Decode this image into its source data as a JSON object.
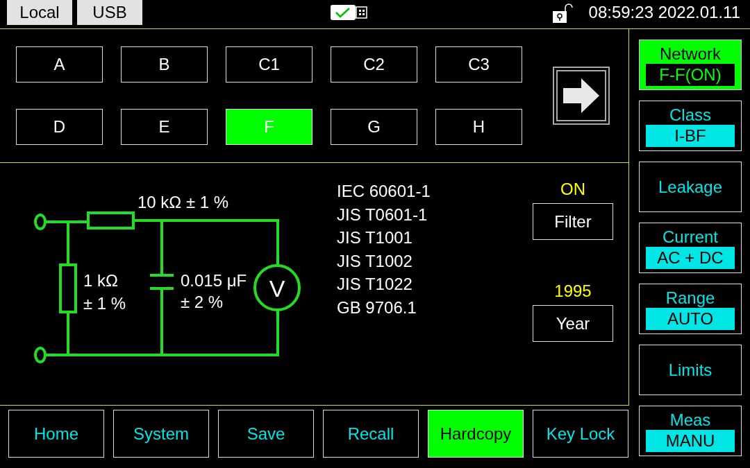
{
  "top_bar": {
    "tabs": [
      {
        "label": "Local"
      },
      {
        "label": "USB"
      }
    ],
    "clock": "08:59:23 2022.01.11"
  },
  "networks": [
    {
      "label": "A",
      "selected": false
    },
    {
      "label": "B",
      "selected": false
    },
    {
      "label": "C1",
      "selected": false
    },
    {
      "label": "C2",
      "selected": false
    },
    {
      "label": "C3",
      "selected": false
    },
    {
      "label": "D",
      "selected": false
    },
    {
      "label": "E",
      "selected": false
    },
    {
      "label": "F",
      "selected": true
    },
    {
      "label": "G",
      "selected": false
    },
    {
      "label": "H",
      "selected": false
    }
  ],
  "circuit": {
    "series_resistor": "10 kΩ ± 1 %",
    "shunt_resistor": [
      "1 kΩ",
      "± 1 %"
    ],
    "capacitor": [
      "0.015 μF",
      "± 2 %"
    ],
    "meter": "V"
  },
  "standards": [
    "IEC 60601-1",
    "JIS T0601-1",
    "JIS T1001",
    "JIS T1002",
    "JIS T1022",
    "GB 9706.1"
  ],
  "filter": {
    "status": "ON",
    "label": "Filter"
  },
  "year": {
    "value": "1995",
    "label": "Year"
  },
  "side_menu": [
    {
      "label": "Network",
      "value": "F-F(ON)",
      "selected": true
    },
    {
      "label": "Class",
      "value": "I-BF",
      "selected": false
    },
    {
      "label": "Leakage",
      "selected": false
    },
    {
      "label": "Current",
      "value": "AC + DC",
      "selected": false
    },
    {
      "label": "Range",
      "value": "AUTO",
      "selected": false
    },
    {
      "label": "Limits",
      "selected": false
    },
    {
      "label": "Meas",
      "value": "MANU",
      "selected": false
    }
  ],
  "bottom_menu": [
    {
      "label": "Home",
      "selected": false
    },
    {
      "label": "System",
      "selected": false
    },
    {
      "label": "Save",
      "selected": false
    },
    {
      "label": "Recall",
      "selected": false
    },
    {
      "label": "Hardcopy",
      "selected": true
    },
    {
      "label": "Key Lock",
      "selected": false
    }
  ]
}
